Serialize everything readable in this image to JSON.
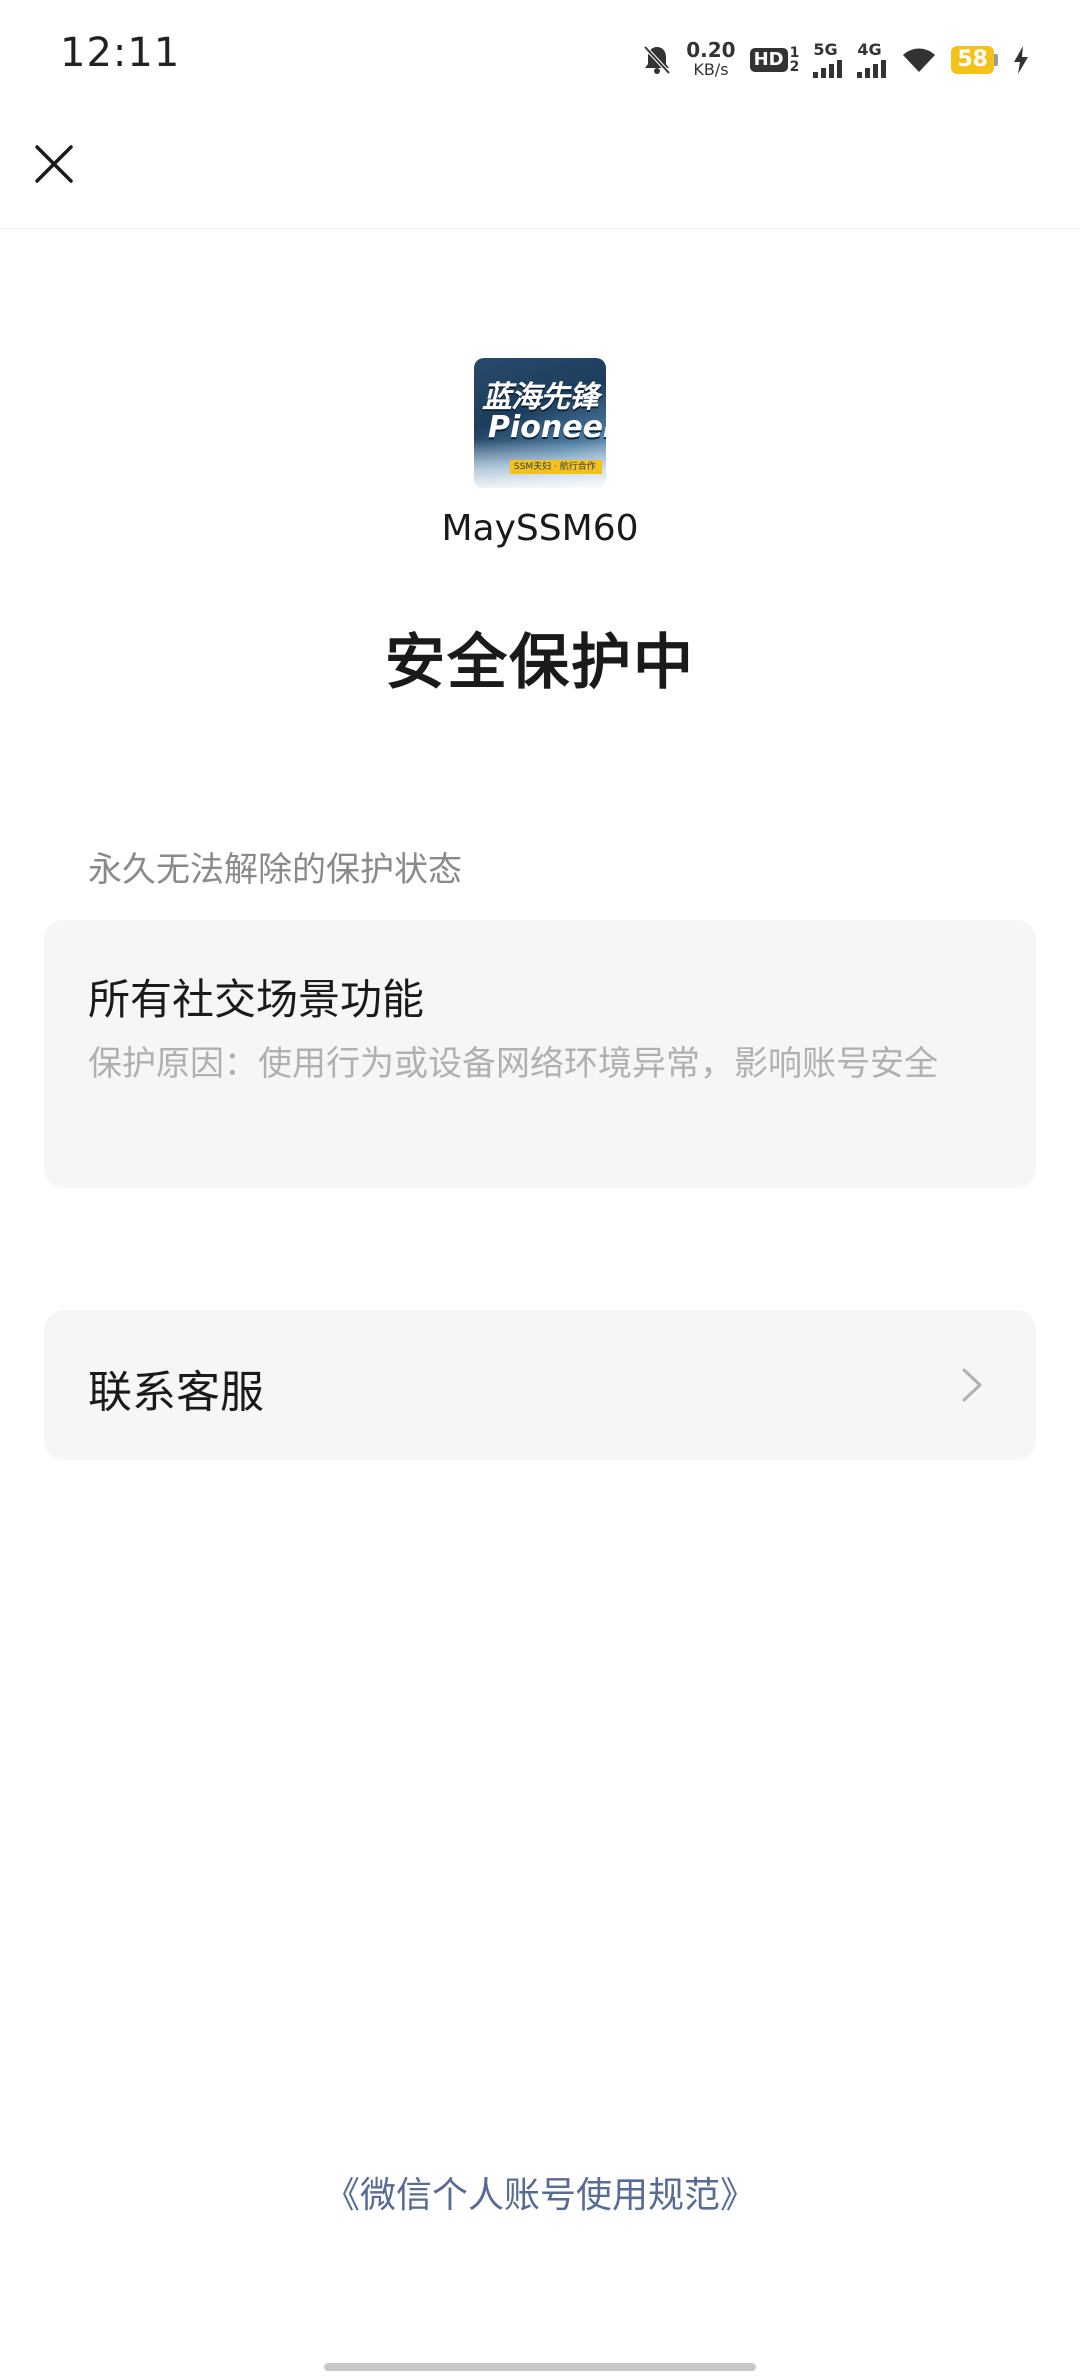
{
  "status_bar": {
    "time": "12:11",
    "net_speed_value": "0.20",
    "net_speed_unit": "KB/s",
    "hd_label": "HD",
    "hd_sub_top": "1",
    "hd_sub_bottom": "2",
    "network_1": "5G",
    "network_2": "4G",
    "battery_level": "58",
    "icons": [
      "bell-muted-icon",
      "signal-bars-icon",
      "wifi-icon",
      "charging-bolt-icon"
    ],
    "battery_color": "#f5c21b"
  },
  "nav": {
    "close_icon": "close-icon"
  },
  "account": {
    "logo_line1": "蓝海先锋",
    "logo_line2": "Pioneer",
    "logo_strip": "SSM夫妇 · 航行合作",
    "name": "MaySSM60"
  },
  "page": {
    "title": "安全保护中"
  },
  "restriction_section": {
    "label": "永久无法解除的保护状态",
    "card_title": "所有社交场景功能",
    "reason": "保护原因：使用行为或设备网络环境异常，影响账号安全"
  },
  "support": {
    "label": "联系客服",
    "chevron_icon": "chevron-right-icon"
  },
  "footer": {
    "link": "《微信个人账号使用规范》",
    "link_color": "#576b95"
  }
}
